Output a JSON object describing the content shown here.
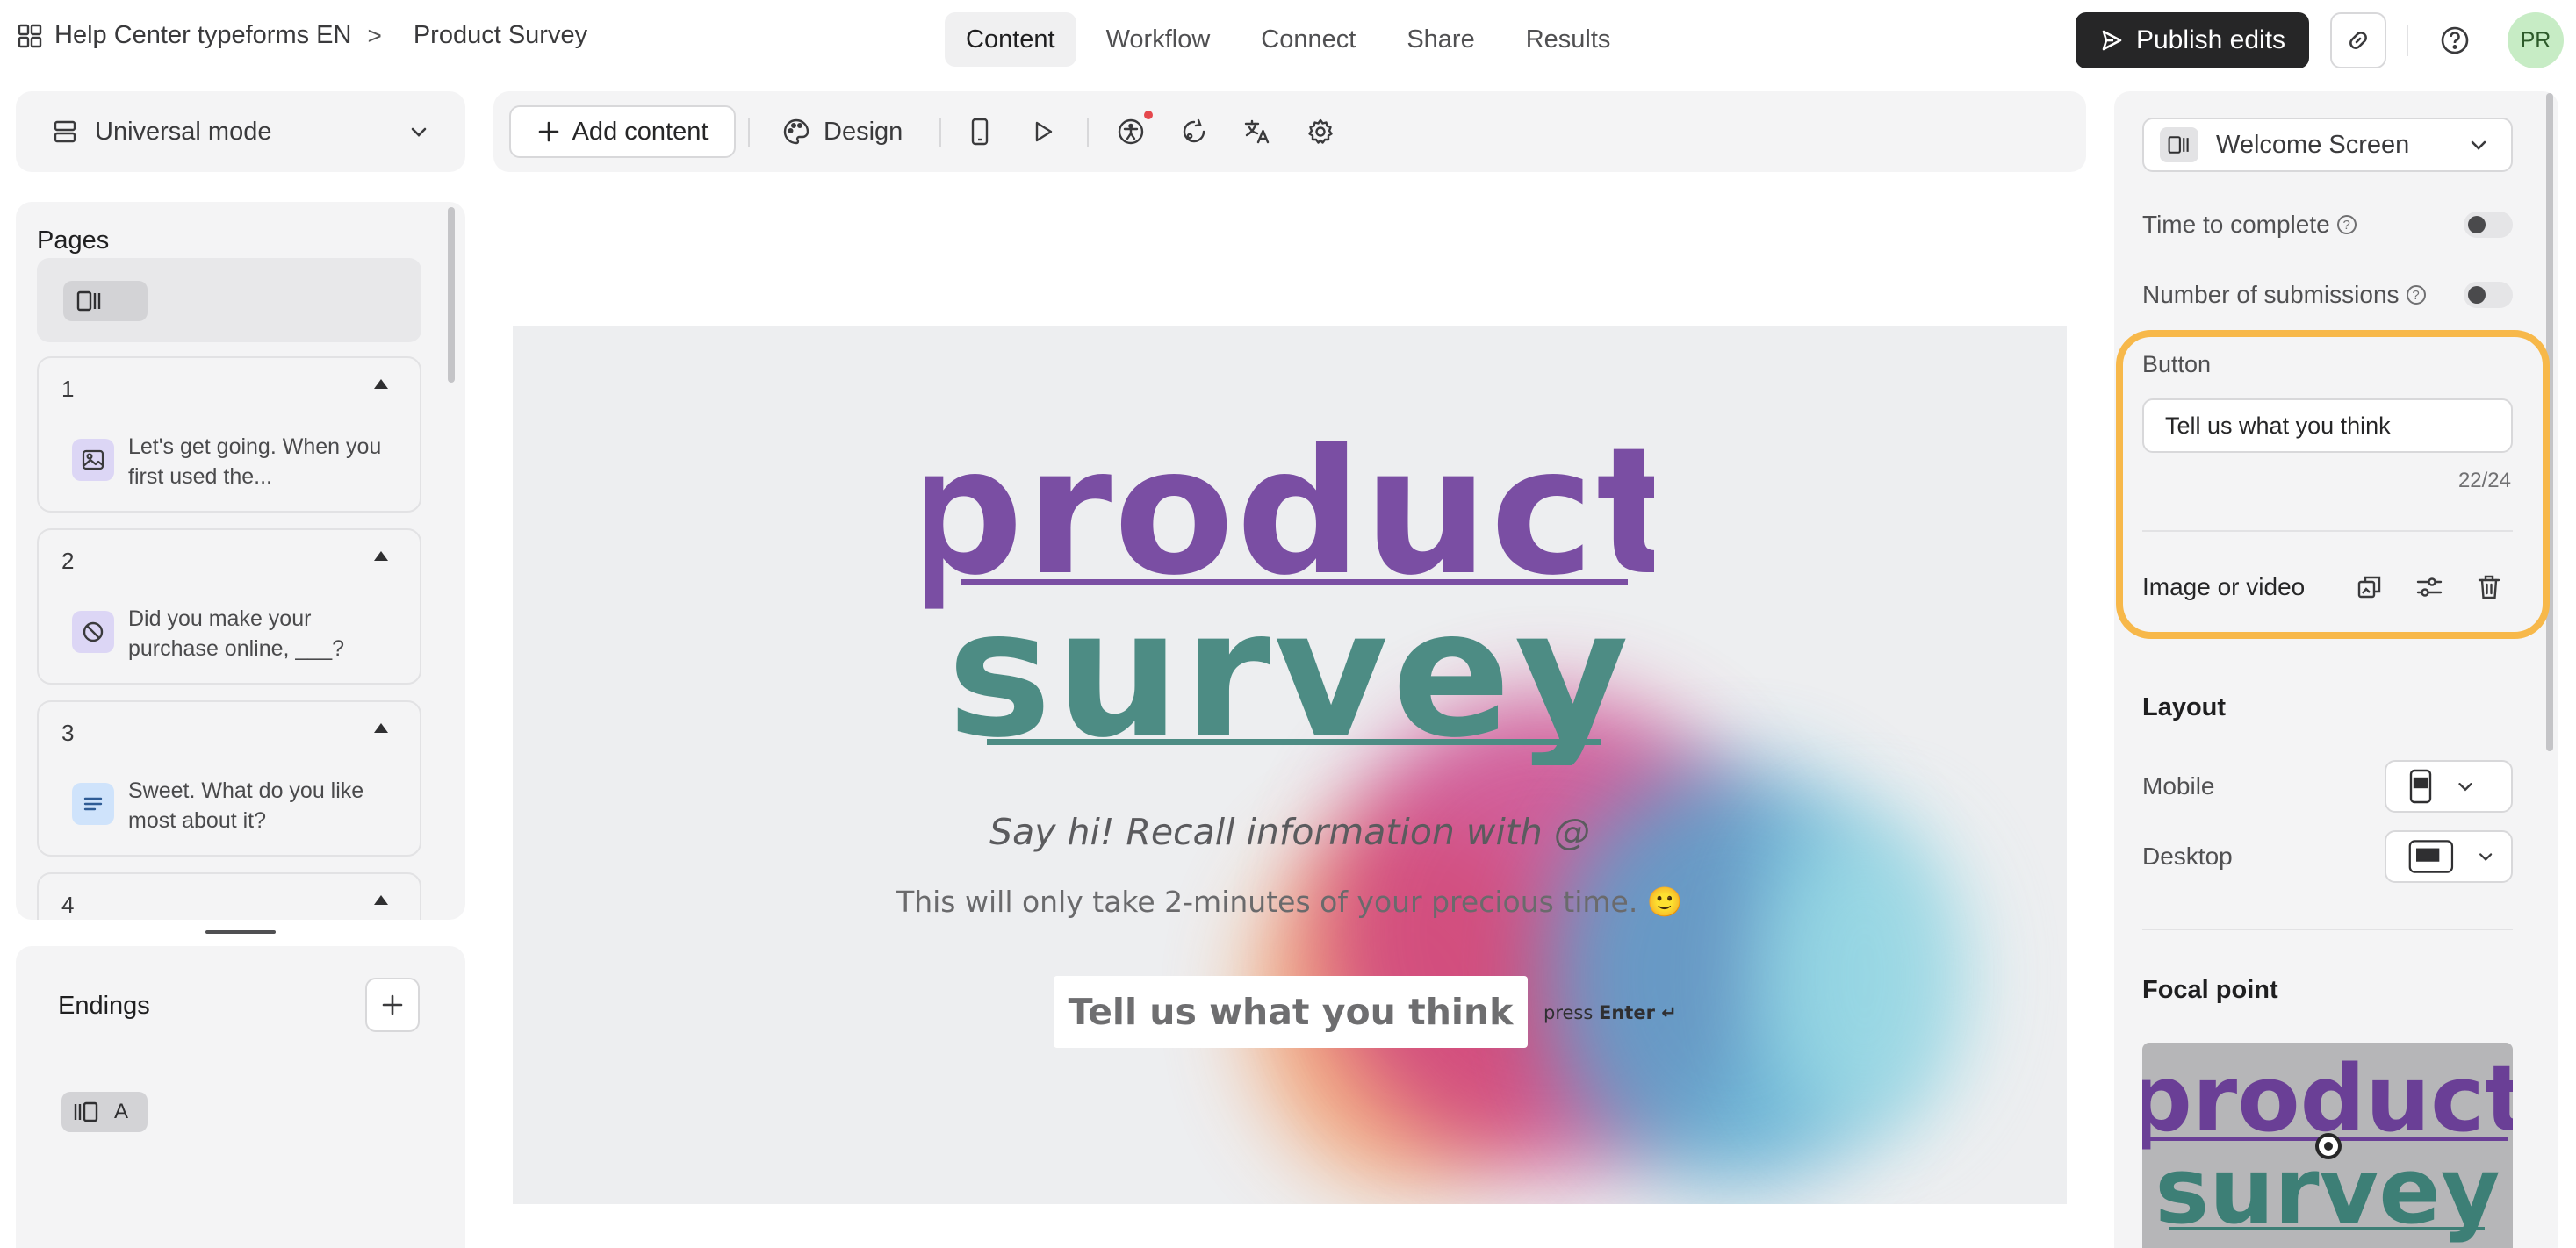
{
  "header": {
    "workspace": "Help Center typeforms EN",
    "separator": ">",
    "form_title": "Product Survey",
    "tabs": [
      {
        "label": "Content",
        "active": true
      },
      {
        "label": "Workflow",
        "active": false
      },
      {
        "label": "Connect",
        "active": false
      },
      {
        "label": "Share",
        "active": false
      },
      {
        "label": "Results",
        "active": false
      }
    ],
    "publish_label": "Publish edits",
    "avatar_initials": "PR"
  },
  "left": {
    "mode_label": "Universal mode",
    "pages_title": "Pages",
    "pages": [
      {
        "num": "1",
        "text": "Let's get going. When you first used the...",
        "icon": "image-icon",
        "icon_bg": "#dcd6f5"
      },
      {
        "num": "2",
        "text": "Did you make your purchase online, ___?",
        "icon": "block-icon",
        "icon_bg": "#dcd6f5"
      },
      {
        "num": "3",
        "text": "Sweet. What do you like most about it?",
        "icon": "lines-icon",
        "icon_bg": "#cfe3fb"
      },
      {
        "num": "4",
        "text": "",
        "icon": "",
        "icon_bg": ""
      }
    ],
    "endings_title": "Endings",
    "ending_chip_label": "A"
  },
  "toolbar": {
    "add_content_label": "Add content",
    "design_label": "Design"
  },
  "canvas": {
    "logo_line1": "product",
    "logo_line2": "survey",
    "subtitle_italic": "Say hi! Recall information with @",
    "subtitle": "This will only take 2-minutes of your precious time. 🙂",
    "cta_label": "Tell us what you think",
    "press_label": "press",
    "enter_label": "Enter ↵",
    "colors": {
      "purple": "#7a4ea3",
      "teal": "#4d8c84"
    }
  },
  "right": {
    "screen_label": "Welcome Screen",
    "time_to_complete": "Time to complete",
    "num_submissions": "Number of submissions",
    "help_glyph": "?",
    "button_section": "Button",
    "button_value": "Tell us what you think",
    "button_counter": "22/24",
    "image_or_video": "Image or video",
    "layout_title": "Layout",
    "mobile_label": "Mobile",
    "desktop_label": "Desktop",
    "focal_title": "Focal point",
    "accent_highlight": "#f7b84a"
  }
}
